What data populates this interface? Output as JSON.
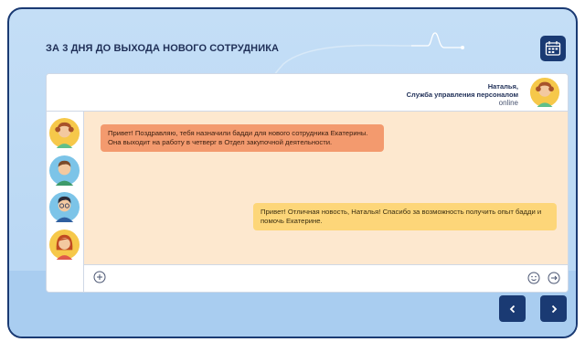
{
  "slide": {
    "title": "ЗА 3 ДНЯ ДО ВЫХОДА НОВОГО СОТРУДНИКА"
  },
  "contact": {
    "name": "Наталья,",
    "department": "Служба управления персоналом",
    "status": "online"
  },
  "messages": [
    {
      "direction": "incoming",
      "text": "Привет! Поздравляю, тебя назначили бадди для нового сотрудника Екатерины. Она выходит на работу в четверг в Отдел закупочной деятельности."
    },
    {
      "direction": "outgoing",
      "text": "Привет! Отличная новость, Наталья! Спасибо за возможность получить опыт бадди и помочь Екатерине."
    }
  ],
  "icons": {
    "calendar": "calendar-icon",
    "plus": "plus-icon",
    "smile": "smile-icon",
    "send": "send-arrow-icon",
    "prev": "chevron-left-icon",
    "next": "chevron-right-icon"
  },
  "colors": {
    "navy": "#1a3a73",
    "background": "#c4def6",
    "chat_bg": "#fde8cf",
    "incoming_bubble": "#f39a6e",
    "outgoing_bubble": "#fdd679"
  }
}
